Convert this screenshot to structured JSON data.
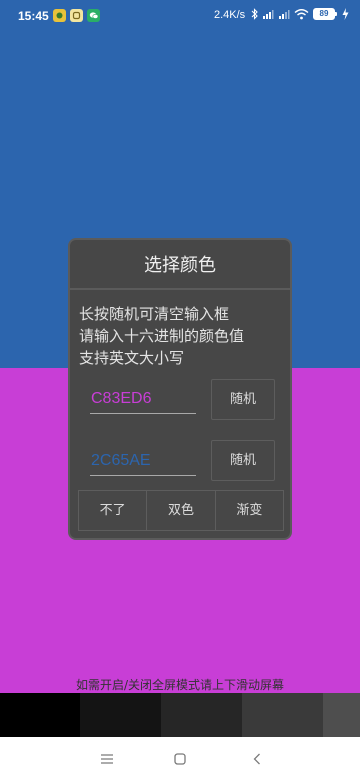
{
  "status_bar": {
    "time": "15:45",
    "net_speed": "2.4K/s",
    "battery": "89",
    "notification_icons": [
      "game-app-icon",
      "ai-app-icon",
      "wechat-icon"
    ],
    "system_icons": [
      "bluetooth-icon",
      "signal-hd1-icon",
      "signal-hd2-icon",
      "wifi-icon",
      "battery-icon",
      "charging-icon"
    ]
  },
  "colors": {
    "color1": "#C83ED6",
    "color2": "#2C65AE"
  },
  "dialog": {
    "title": "选择颜色",
    "message_lines": [
      "长按随机可清空输入框",
      "请输入十六进制的颜色值",
      "支持英文大小写"
    ],
    "input1_value": "C83ED6",
    "input2_value": "2C65AE",
    "random_label": "随机",
    "buttons": {
      "cancel": "不了",
      "dual": "双色",
      "gradient": "渐变"
    }
  },
  "hint": "如需开启/关闭全屏模式请上下滑动屏幕",
  "swatches": [
    "#000000",
    "#141414",
    "#262626",
    "#3a3a3a",
    "#4e4e4e"
  ],
  "nav": [
    "menu-icon",
    "home-icon",
    "back-icon"
  ]
}
